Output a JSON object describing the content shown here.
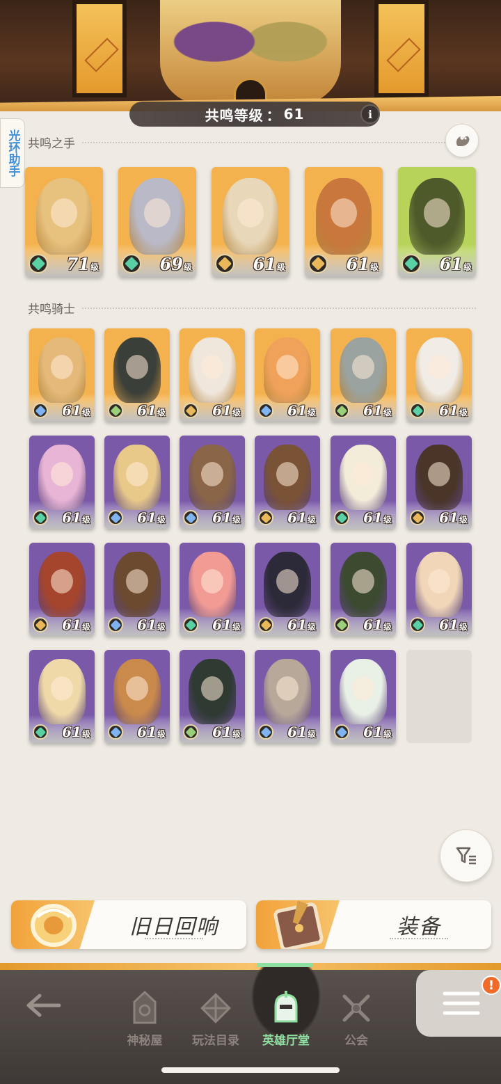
{
  "header": {
    "resonance_label": "共鸣等级",
    "separator": "：",
    "resonance_level": "61",
    "info_icon": "i"
  },
  "assistant_tab": {
    "label": "光环助手"
  },
  "hand_section": {
    "title": "共鸣之手",
    "skill_icon": "squirrel-icon",
    "heroes": [
      {
        "level": "71",
        "unit": "级",
        "faction": "green",
        "frame": "orange",
        "hue": "#e7c17e"
      },
      {
        "level": "69",
        "unit": "级",
        "faction": "green",
        "frame": "orange",
        "hue": "#b9b9c7"
      },
      {
        "level": "61",
        "unit": "级",
        "faction": "gold",
        "frame": "orange",
        "hue": "#e8d7b8"
      },
      {
        "level": "61",
        "unit": "级",
        "faction": "gold",
        "frame": "orange",
        "hue": "#c9773c"
      },
      {
        "level": "61",
        "unit": "级",
        "faction": "green",
        "frame": "green",
        "hue": "#4e5a2a"
      }
    ]
  },
  "knight_section": {
    "title": "共鸣骑士",
    "heroes": [
      {
        "level": "61",
        "unit": "级",
        "faction": "blue",
        "frame": "orange",
        "hue": "#e4b979"
      },
      {
        "level": "61",
        "unit": "级",
        "faction": "dark",
        "frame": "orange",
        "hue": "#3a3f3a"
      },
      {
        "level": "61",
        "unit": "级",
        "faction": "gold",
        "frame": "orange",
        "hue": "#efe6dc"
      },
      {
        "level": "61",
        "unit": "级",
        "faction": "blue",
        "frame": "orange",
        "hue": "#f0a25a"
      },
      {
        "level": "61",
        "unit": "级",
        "faction": "dark",
        "frame": "orange",
        "hue": "#9aa3a0"
      },
      {
        "level": "61",
        "unit": "级",
        "faction": "green",
        "frame": "orange",
        "hue": "#f1ece6"
      },
      {
        "level": "61",
        "unit": "级",
        "faction": "green",
        "frame": "purple",
        "hue": "#e9b5d6"
      },
      {
        "level": "61",
        "unit": "级",
        "faction": "blue",
        "frame": "purple",
        "hue": "#e8c98a"
      },
      {
        "level": "61",
        "unit": "级",
        "faction": "blue",
        "frame": "purple",
        "hue": "#8a6548"
      },
      {
        "level": "61",
        "unit": "级",
        "faction": "gold",
        "frame": "purple",
        "hue": "#7a5236"
      },
      {
        "level": "61",
        "unit": "级",
        "faction": "green",
        "frame": "purple",
        "hue": "#f3ecd9"
      },
      {
        "level": "61",
        "unit": "级",
        "faction": "gold",
        "frame": "purple",
        "hue": "#4a3528"
      },
      {
        "level": "61",
        "unit": "级",
        "faction": "gold",
        "frame": "purple",
        "hue": "#a5452e"
      },
      {
        "level": "61",
        "unit": "级",
        "faction": "blue",
        "frame": "purple",
        "hue": "#6b4a30"
      },
      {
        "level": "61",
        "unit": "级",
        "faction": "green",
        "frame": "purple",
        "hue": "#f29b95"
      },
      {
        "level": "61",
        "unit": "级",
        "faction": "gold",
        "frame": "purple",
        "hue": "#2c2a38"
      },
      {
        "level": "61",
        "unit": "级",
        "faction": "dark",
        "frame": "purple",
        "hue": "#3c4a30"
      },
      {
        "level": "61",
        "unit": "级",
        "faction": "green",
        "frame": "purple",
        "hue": "#f1d6b8"
      },
      {
        "level": "61",
        "unit": "级",
        "faction": "green",
        "frame": "purple",
        "hue": "#efd9a8"
      },
      {
        "level": "61",
        "unit": "级",
        "faction": "blue",
        "frame": "purple",
        "hue": "#c98a4c"
      },
      {
        "level": "61",
        "unit": "级",
        "faction": "dark",
        "frame": "purple",
        "hue": "#2f3a33"
      },
      {
        "level": "61",
        "unit": "级",
        "faction": "blue",
        "frame": "purple",
        "hue": "#b8a89a"
      },
      {
        "level": "61",
        "unit": "级",
        "faction": "blue",
        "frame": "purple",
        "hue": "#e9f0e6"
      }
    ]
  },
  "filter_icon": "filter-icon",
  "actions": {
    "left_label": "旧日回响",
    "right_label": "装备"
  },
  "nav": {
    "back_icon": "back-arrow-icon",
    "items": [
      {
        "label": "神秘屋",
        "icon": "mystery-house-icon"
      },
      {
        "label": "玩法目录",
        "icon": "game-modes-icon"
      },
      {
        "label": "英雄厅堂",
        "icon": "hero-hall-icon",
        "active": true
      },
      {
        "label": "公会",
        "icon": "guild-icon"
      }
    ],
    "menu_icon": "menu-icon",
    "menu_badge": "!"
  },
  "colors": {
    "frame_orange": "#f3b24e",
    "frame_purple": "#7a5aa8",
    "frame_green": "#b7d35a",
    "faction_green": "#5ad1a5",
    "faction_gold": "#e8b85a",
    "faction_blue": "#7fb4f0",
    "faction_dark": "#9ad07a",
    "nav_active": "#8fe0a0"
  }
}
